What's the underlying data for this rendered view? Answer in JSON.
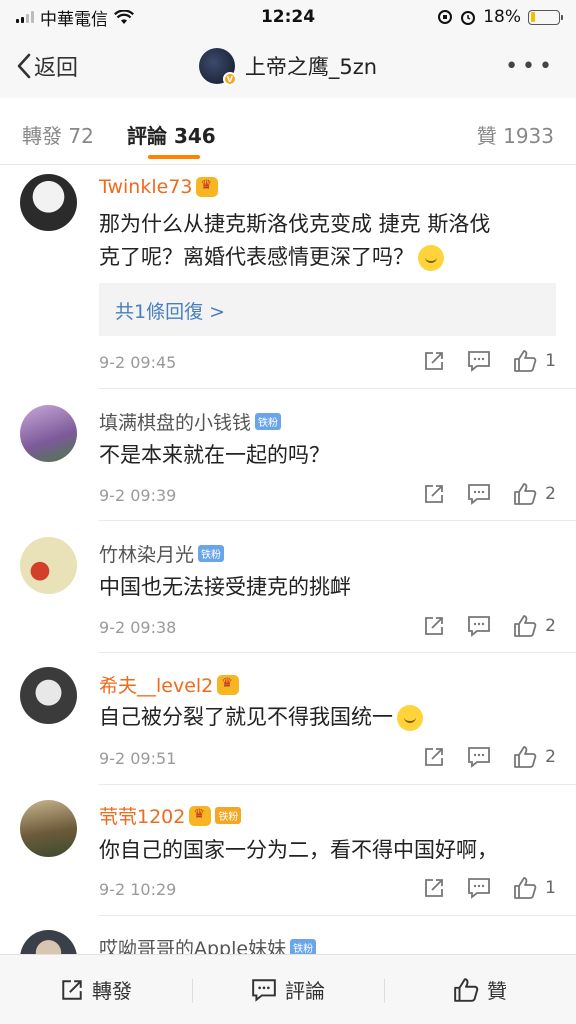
{
  "statusbar": {
    "carrier": "中華電信",
    "time": "12:24",
    "battery_percent": "18%",
    "battery_level": 0.18
  },
  "navbar": {
    "back_label": "返回",
    "title": "上帝之鹰_5zn",
    "more": "•••"
  },
  "tabs": [
    {
      "label": "轉發 72"
    },
    {
      "label": "評論 346"
    },
    {
      "label": "贊 1933"
    }
  ],
  "comments": [
    {
      "name": "Twinkle73",
      "text_line1": "那为什么从捷克斯洛伐克变成 捷克  斯洛伐",
      "text_line2": "克了呢？离婚代表感情更深了吗？",
      "reply": "共1條回復 >",
      "time": "9-2 09:45",
      "likes": "1"
    },
    {
      "name": "填满棋盘的小钱钱",
      "badge": "铁粉",
      "text_line1": "不是本来就在一起的吗？",
      "time": "9-2 09:39",
      "likes": "2"
    },
    {
      "name": "竹林染月光",
      "badge": "铁粉",
      "text_line1": "中国也无法接受捷克的挑衅",
      "time": "9-2 09:38",
      "likes": "2"
    },
    {
      "name": "希夫__level2",
      "text_line1": "自己被分裂了就见不得我国统一",
      "time": "9-2 09:51",
      "likes": "2"
    },
    {
      "name": "茕茕1202",
      "badge": "铁粉",
      "text_line1": "你自己的国家一分为二，看不得中国好啊，",
      "time": "9-2 10:29",
      "likes": "1"
    },
    {
      "name": "哎呦哥哥的Apple妹妹",
      "badge": "铁粉"
    }
  ],
  "bottombar": {
    "repost": "轉發",
    "comment": "評論",
    "like": "贊"
  }
}
